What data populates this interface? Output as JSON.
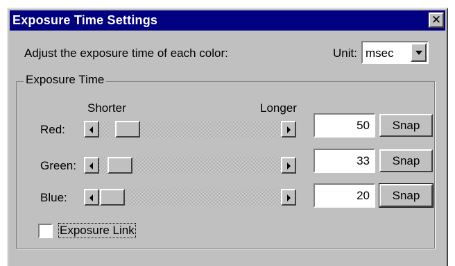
{
  "window": {
    "title": "Exposure Time Settings",
    "close_glyph": "✕"
  },
  "instruction": "Adjust the exposure time of each color:",
  "unit": {
    "label": "Unit:",
    "selected": "msec"
  },
  "group": {
    "label": "Exposure Time",
    "scale_min_label": "Shorter",
    "scale_max_label": "Longer"
  },
  "channels": [
    {
      "label": "Red:",
      "value": "50",
      "snap_label": "Snap"
    },
    {
      "label": "Green:",
      "value": "33",
      "snap_label": "Snap"
    },
    {
      "label": "Blue:",
      "value": "20",
      "snap_label": "Snap"
    }
  ],
  "exposure_link": {
    "label": "Exposure Link",
    "checked": false
  },
  "colors": {
    "titlebar": "#000080",
    "face": "#c0c0c0"
  },
  "icons": [
    "close-icon",
    "chevron-down-icon",
    "arrow-left-icon",
    "arrow-right-icon"
  ]
}
